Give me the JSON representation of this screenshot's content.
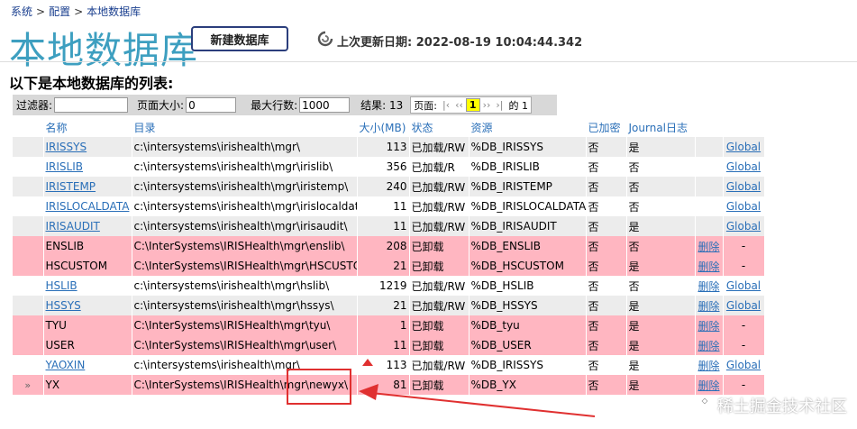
{
  "breadcrumb": {
    "item1": "系统",
    "item2": "配置",
    "item3": "本地数据库",
    "sep": ">"
  },
  "title": "本地数据库",
  "new_db_button": "新建数据库",
  "last_update": "上次更新日期: 2022-08-19 10:04:44.342",
  "list_heading": "以下是本地数据库的列表:",
  "filter": {
    "filter_label": "过滤器:",
    "filter_value": "",
    "page_size_label": "页面大小:",
    "page_size_value": "0",
    "max_rows_label": "最大行数:",
    "max_rows_value": "1000",
    "results_label": "结果: 13",
    "page_label": "页面:",
    "pager_first": "|‹",
    "pager_prev": "‹‹",
    "pager_current": "1",
    "pager_next": "››",
    "pager_last": "›|",
    "pager_of": "的 1"
  },
  "columns": [
    "名称",
    "目录",
    "大小(MB)",
    "状态",
    "资源",
    "已加密",
    "Journal日志",
    "",
    ""
  ],
  "rows": [
    {
      "marker": "",
      "name": "IRISSYS",
      "dir": "c:\\intersystems\\irishealth\\mgr\\",
      "size": "113",
      "status": "已加载/RW",
      "resource": "%DB_IRISSYS",
      "encrypted": "否",
      "journal": "是",
      "delete": "",
      "global": "Global",
      "style": "odd",
      "name_link": true
    },
    {
      "marker": "",
      "name": "IRISLIB",
      "dir": "c:\\intersystems\\irishealth\\mgr\\irislib\\",
      "size": "356",
      "status": "已加载/R",
      "resource": "%DB_IRISLIB",
      "encrypted": "否",
      "journal": "否",
      "delete": "",
      "global": "Global",
      "style": "even",
      "name_link": true
    },
    {
      "marker": "",
      "name": "IRISTEMP",
      "dir": "c:\\intersystems\\irishealth\\mgr\\iristemp\\",
      "size": "240",
      "status": "已加载/RW",
      "resource": "%DB_IRISTEMP",
      "encrypted": "否",
      "journal": "否",
      "delete": "",
      "global": "Global",
      "style": "odd",
      "name_link": true
    },
    {
      "marker": "",
      "name": "IRISLOCALDATA",
      "dir": "c:\\intersystems\\irishealth\\mgr\\irislocaldata\\",
      "size": "11",
      "status": "已加载/RW",
      "resource": "%DB_IRISLOCALDATA",
      "encrypted": "否",
      "journal": "否",
      "delete": "",
      "global": "Global",
      "style": "even",
      "name_link": true
    },
    {
      "marker": "",
      "name": "IRISAUDIT",
      "dir": "c:\\intersystems\\irishealth\\mgr\\irisaudit\\",
      "size": "11",
      "status": "已加载/RW",
      "resource": "%DB_IRISAUDIT",
      "encrypted": "否",
      "journal": "是",
      "delete": "",
      "global": "Global",
      "style": "odd",
      "name_link": true
    },
    {
      "marker": "",
      "name": "ENSLIB",
      "dir": "C:\\InterSystems\\IRISHealth\\mgr\\enslib\\",
      "size": "208",
      "status": "已卸载",
      "resource": "%DB_ENSLIB",
      "encrypted": "否",
      "journal": "否",
      "delete": "删除",
      "global": "-",
      "style": "pink",
      "name_link": false
    },
    {
      "marker": "",
      "name": "HSCUSTOM",
      "dir": "C:\\InterSystems\\IRISHealth\\mgr\\HSCUSTOM\\",
      "size": "21",
      "status": "已卸载",
      "resource": "%DB_HSCUSTOM",
      "encrypted": "否",
      "journal": "是",
      "delete": "删除",
      "global": "-",
      "style": "pink",
      "name_link": false
    },
    {
      "marker": "",
      "name": "HSLIB",
      "dir": "c:\\intersystems\\irishealth\\mgr\\hslib\\",
      "size": "1219",
      "status": "已加载/RW",
      "resource": "%DB_HSLIB",
      "encrypted": "否",
      "journal": "否",
      "delete": "删除",
      "global": "Global",
      "style": "even",
      "name_link": true
    },
    {
      "marker": "",
      "name": "HSSYS",
      "dir": "c:\\intersystems\\irishealth\\mgr\\hssys\\",
      "size": "21",
      "status": "已加载/RW",
      "resource": "%DB_HSSYS",
      "encrypted": "否",
      "journal": "是",
      "delete": "删除",
      "global": "Global",
      "style": "odd",
      "name_link": true
    },
    {
      "marker": "",
      "name": "TYU",
      "dir": "C:\\InterSystems\\IRISHealth\\mgr\\tyu\\",
      "size": "1",
      "status": "已卸载",
      "resource": "%DB_tyu",
      "encrypted": "否",
      "journal": "是",
      "delete": "删除",
      "global": "-",
      "style": "pink",
      "name_link": false
    },
    {
      "marker": "",
      "name": "USER",
      "dir": "C:\\InterSystems\\IRISHealth\\mgr\\user\\",
      "size": "11",
      "status": "已卸载",
      "resource": "%DB_USER",
      "encrypted": "否",
      "journal": "是",
      "delete": "删除",
      "global": "-",
      "style": "pink",
      "name_link": false
    },
    {
      "marker": "",
      "name": "YAOXIN",
      "dir": "c:\\intersystems\\irishealth\\mgr\\",
      "size": "113",
      "status": "已加载/RW",
      "resource": "%DB_IRISSYS",
      "encrypted": "否",
      "journal": "是",
      "delete": "删除",
      "global": "Global",
      "style": "even",
      "name_link": true
    },
    {
      "marker": "»",
      "name": "YX",
      "dir": "C:\\InterSystems\\IRISHealth\\mgr\\newyx\\",
      "size": "81",
      "status": "已卸载",
      "resource": "%DB_YX",
      "encrypted": "否",
      "journal": "是",
      "delete": "删除",
      "global": "-",
      "style": "pink",
      "name_link": false
    }
  ],
  "watermark": "稀土掘金技术社区",
  "colors": {
    "title": "#3d9fc0",
    "link": "#2a6fb8",
    "unmounted_row": "#ffb6c1",
    "annotation": "#e03030"
  }
}
